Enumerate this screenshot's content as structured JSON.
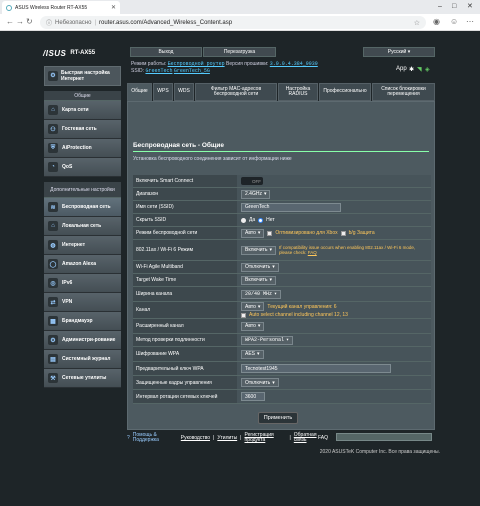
{
  "browser": {
    "tab_title": "ASUS Wireless Router RT-AX55",
    "insecure_label": "Небезопасно",
    "url": "router.asus.com/Advanced_Wireless_Content.asp"
  },
  "router": {
    "logo": "/ISUS",
    "model": "RT-AX55",
    "logout": "Выход",
    "reboot": "Перезагрузка",
    "language": "Русский",
    "mode_label": "Режим работы:",
    "mode_value": "Беспроводной роутер",
    "fw_label": "Версия прошивки:",
    "fw_value": "3.0.0.4.384_9939",
    "ssid_label": "SSID:",
    "ssid1": "GreenTech",
    "ssid2": "GreenTech_5G",
    "app_label": "App"
  },
  "sidebar": {
    "quick_setup": "Быстрая настройка Интернет",
    "general_header": "Общие",
    "advanced_header": "Дополнительные настройки",
    "general": [
      {
        "label": "Карта сети",
        "icon": "network-map-icon"
      },
      {
        "label": "Гостевая сеть",
        "icon": "guest-network-icon"
      },
      {
        "label": "AiProtection",
        "icon": "aiprotection-icon"
      },
      {
        "label": "QoS",
        "icon": "qos-icon"
      }
    ],
    "advanced": [
      {
        "label": "Беспроводная сеть",
        "icon": "wireless-icon"
      },
      {
        "label": "Локальная сеть",
        "icon": "lan-icon"
      },
      {
        "label": "Интернет",
        "icon": "internet-icon"
      },
      {
        "label": "Amazon Alexa",
        "icon": "alexa-icon"
      },
      {
        "label": "IPv6",
        "icon": "ipv6-icon"
      },
      {
        "label": "VPN",
        "icon": "vpn-icon"
      },
      {
        "label": "Брандмауэр",
        "icon": "firewall-icon"
      },
      {
        "label": "Администри-рование",
        "icon": "admin-icon"
      },
      {
        "label": "Системный журнал",
        "icon": "syslog-icon"
      },
      {
        "label": "Сетевые утилиты",
        "icon": "tools-icon"
      }
    ]
  },
  "tabs": [
    "Общие",
    "WPS",
    "WDS",
    "Фильтр MAC-адресов беспроводной сети",
    "Настройка RADIUS",
    "Профессионально",
    "Список блокировки перемещения"
  ],
  "content": {
    "title": "Беспроводная сеть - Общие",
    "desc": "Установка беспроводного соединения зависит от информации ниже",
    "rows": {
      "smart_connect": {
        "label": "Включить Smart Connect",
        "value": "OFF"
      },
      "band": {
        "label": "Диапазон",
        "value": "2.4GHz"
      },
      "ssid": {
        "label": "Имя сети (SSID)",
        "value": "GreenTech"
      },
      "hide": {
        "label": "Скрыть SSID",
        "yes": "Да",
        "no": "Нет"
      },
      "mode": {
        "label": "Режим беспроводной сети",
        "value": "Авто",
        "opt1": "Оптимизировано для Xbox",
        "opt2": "b/g Защита"
      },
      "ax": {
        "label": "802.11ax / Wi-Fi 6 Режим",
        "value": "Включить",
        "note": "If compatibility issue occurs when enabling 802.11ax / Wi-Fi 6 mode, please check:",
        "faq": "FAQ"
      },
      "agile": {
        "label": "Wi-Fi Agile Multiband",
        "value": "Отключить"
      },
      "twt": {
        "label": "Target Wake Time",
        "value": "Включить"
      },
      "width": {
        "label": "Ширина канала",
        "value": "20/40 MHz"
      },
      "channel": {
        "label": "Канал",
        "value": "Авто",
        "status": "Текущий канал управления: 6",
        "auto": "Auto select channel including channel 12, 13"
      },
      "ext": {
        "label": "Расширенный канал",
        "value": "Авто"
      },
      "auth": {
        "label": "Метод проверки подлинности",
        "value": "WPA2-Personal"
      },
      "enc": {
        "label": "Шифрование WPA",
        "value": "AES"
      },
      "key": {
        "label": "Предварительный ключ WPA",
        "value": "Tecnotest1945"
      },
      "pmf": {
        "label": "Защищенные кадры управления",
        "value": "Отключить"
      },
      "rot": {
        "label": "Интервал ротации сетевых ключей",
        "value": "3600"
      }
    },
    "apply": "Применить"
  },
  "footer": {
    "help": "Помощь & Поддержка",
    "manual": "Руководство",
    "utils": "Утилиты",
    "reg": "Регистрация продукта",
    "feedback": "Обратная связь",
    "faq": "FAQ",
    "copyright": "2020 ASUSTeK Computer Inc. Все права защищены."
  }
}
